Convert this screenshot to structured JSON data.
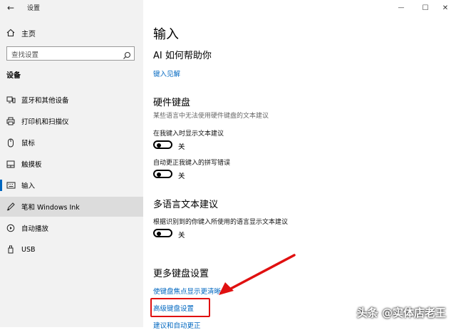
{
  "window": {
    "title": "设置",
    "back_glyph": "←",
    "minimize_glyph": "—",
    "maximize_glyph": "☐",
    "close_glyph": "✕"
  },
  "sidebar": {
    "home_label": "主页",
    "search_placeholder": "查找设置",
    "section_title": "设备",
    "items": [
      {
        "label": "蓝牙和其他设备",
        "icon": "bluetooth-devices-icon"
      },
      {
        "label": "打印机和扫描仪",
        "icon": "printer-icon"
      },
      {
        "label": "鼠标",
        "icon": "mouse-icon"
      },
      {
        "label": "触摸板",
        "icon": "touchpad-icon"
      },
      {
        "label": "输入",
        "icon": "keyboard-icon",
        "active": true
      },
      {
        "label": "笔和 Windows Ink",
        "icon": "pen-icon",
        "hovered": true
      },
      {
        "label": "自动播放",
        "icon": "autoplay-icon"
      },
      {
        "label": "USB",
        "icon": "usb-icon"
      }
    ]
  },
  "main": {
    "title": "输入",
    "ai_section": {
      "heading": "AI 如何帮助你",
      "link": "键入见解"
    },
    "hardware_section": {
      "heading": "硬件键盘",
      "description": "某些语言中无法使用硬件键盘的文本建议",
      "settings": [
        {
          "label": "在我键入时显示文本建议",
          "state": "关"
        },
        {
          "label": "自动更正我键入的拼写错误",
          "state": "关"
        }
      ]
    },
    "multilingual_section": {
      "heading": "多语言文本建议",
      "settings": [
        {
          "label": "根据识别到的你键入所使用的语言显示文本建议",
          "state": "关"
        }
      ]
    },
    "more_section": {
      "heading": "更多键盘设置",
      "links": [
        "使键盘焦点显示更清晰",
        "高级键盘设置",
        "建议和自动更正"
      ]
    }
  },
  "annotation": {
    "color": "#e01010"
  },
  "watermark": "头条 @实体店老王"
}
